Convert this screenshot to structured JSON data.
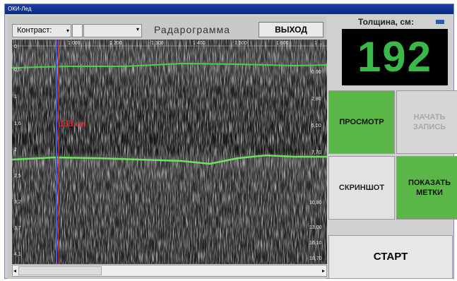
{
  "window": {
    "title": "ОКИ-Лед"
  },
  "toolbar": {
    "contrast_label": "Контраст:",
    "contrast_arrow": "▾",
    "combo_arrow": "▾",
    "radargram_title": "Радарограмма",
    "exit_label": "ВЫХОД"
  },
  "radargram": {
    "top_ticks": [
      "1 000",
      "1 200",
      "1 300",
      "1 400",
      "1 500",
      "1 600",
      "1 ..."
    ],
    "left_ticks": [
      "0",
      "0,5",
      "1",
      "1,6",
      "2",
      "2,5",
      "3,2",
      "3,7",
      "4,1"
    ],
    "right_ticks": [
      "0,00",
      "2,80",
      "5,00",
      "7,70",
      "10,80",
      "13,00",
      "16,10",
      "18,70"
    ],
    "marker_label": "133 см",
    "colors": {
      "upper_boundary": "#49d24a",
      "lower_boundary": "#6ee260",
      "cursor_blue": "#3a5fe0",
      "cursor_red": "#e02020",
      "marker_text": "#ff2020"
    }
  },
  "scrollbar": {
    "left_arrow": "◂",
    "right_arrow": "▸"
  },
  "panel": {
    "thickness_label": "Толщина, см:",
    "thickness_value": "192",
    "view_button": "ПРОСМОТР",
    "record_button": "НАЧАТЬ ЗАПИСЬ",
    "screenshot_button": "СКРИНШОТ",
    "show_marks_button": "ПОКАЗАТЬ МЕТКИ",
    "start_button": "СТАРТ"
  },
  "colors": {
    "display_digits": "#3bb84a",
    "active_tile": "#5ab646"
  }
}
